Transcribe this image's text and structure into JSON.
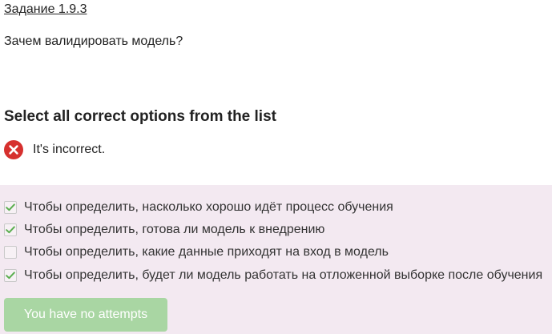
{
  "task": {
    "link_label": "Задание 1.9.3",
    "question": "Зачем валидировать модель?"
  },
  "instruction": "Select all correct options from the list",
  "feedback": {
    "icon": "close-circle-icon",
    "text": "It's incorrect.",
    "color": "#d6302e"
  },
  "options": [
    {
      "label": "Чтобы определить, насколько хорошо идёт процесс обучения",
      "checked": true
    },
    {
      "label": "Чтобы определить, готова ли модель к внедрению",
      "checked": true
    },
    {
      "label": "Чтобы определить, какие данные приходят на вход в модель",
      "checked": false
    },
    {
      "label": "Чтобы определить, будет ли модель работать на отложенной выборке после обучения",
      "checked": true
    }
  ],
  "submit_button": {
    "label": "You have no attempts",
    "disabled": true
  },
  "colors": {
    "panel_background": "#f3e9f1",
    "check_green": "#5aae4f",
    "button_background": "#a9d6a3"
  }
}
